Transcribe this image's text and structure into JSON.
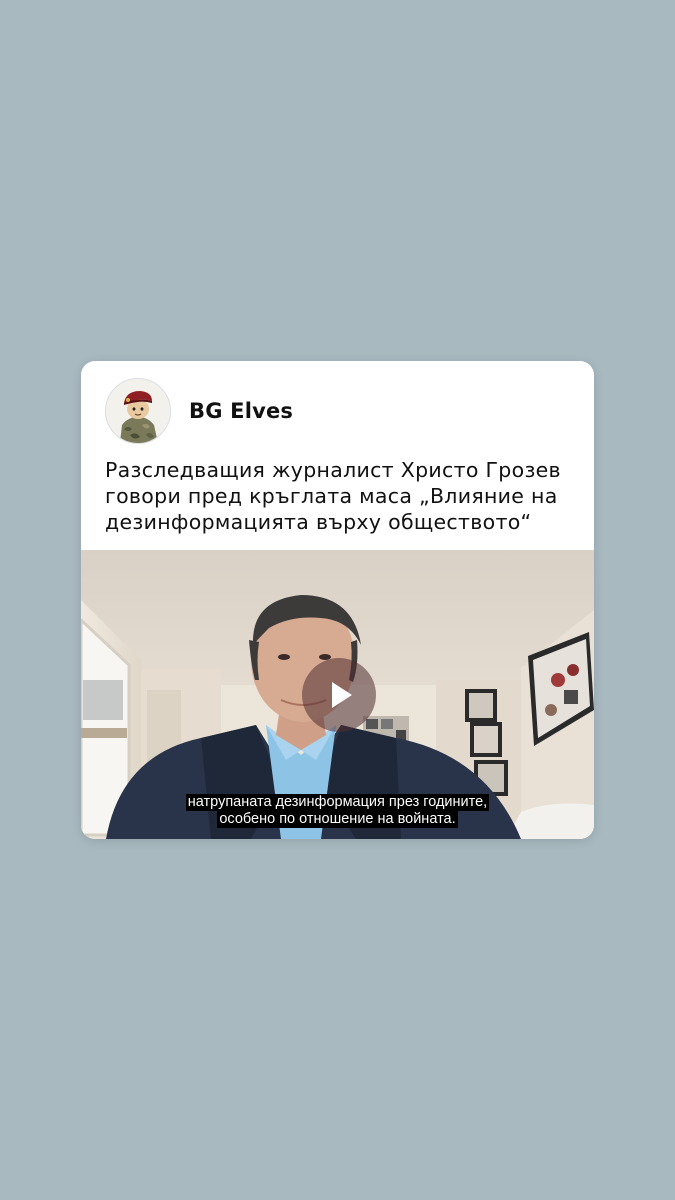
{
  "post": {
    "author": "BG Elves",
    "text": "Разследващия журналист Христо Грозев говори пред кръглата маса „Влияние на дезинформацията върху обществото“"
  },
  "video": {
    "subtitle_line1": "натрупаната дезинформация през годините,",
    "subtitle_line2": "особено по отношение на войната."
  },
  "colors": {
    "page_background": "#a8b9c0",
    "card_background": "#ffffff",
    "text": "#111111",
    "subtitle_background": "#000000"
  },
  "icons": {
    "avatar": "beret-soldier-avatar",
    "play": "play-icon"
  }
}
